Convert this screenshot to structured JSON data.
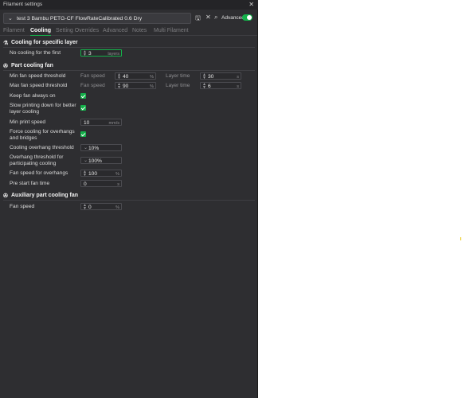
{
  "window": {
    "title": "Filament settings",
    "close_icon": "close-icon"
  },
  "toolbar": {
    "preset_name": "test 3 Bambu PETG-CF FlowRateCalibrated 0.6 Dry",
    "advanced_label": "Advanced",
    "advanced_on": true,
    "accent": "#14b14a"
  },
  "tabs": [
    "Filament",
    "Cooling",
    "Setting Overrides",
    "Advanced",
    "Notes",
    "Multi Filament"
  ],
  "active_tab": "Cooling",
  "cooling_specific_layer": {
    "title": "Cooling for specific layer",
    "no_cooling_label": "No cooling for the first",
    "no_cooling_value": "3",
    "no_cooling_unit": "layers"
  },
  "part_cooling_fan": {
    "title": "Part cooling fan",
    "min_threshold_label": "Min fan speed threshold",
    "max_threshold_label": "Max fan speed threshold",
    "fan_speed_label": "Fan speed",
    "layer_time_label": "Layer time",
    "min_fan_speed": "40",
    "min_layer_time": "30",
    "max_fan_speed": "90",
    "max_layer_time": "6",
    "percent_unit": "%",
    "seconds_unit": "s",
    "keep_fan_label": "Keep fan always on",
    "slow_printing_label": "Slow printing down for better layer cooling",
    "min_print_speed_label": "Min print speed",
    "min_print_speed": "10",
    "speed_unit": "mm/s",
    "force_cooling_label": "Force cooling for overhangs and bridges",
    "overhang_threshold_label": "Cooling overhang threshold",
    "overhang_threshold": "10%",
    "overhang_participating_label": "Overhang threshold for participating cooling",
    "overhang_participating": "100%",
    "fan_overhangs_label": "Fan speed for overhangs",
    "fan_overhangs": "100",
    "pre_start_label": "Pre start fan time",
    "pre_start": "0"
  },
  "aux_fan": {
    "title": "Auxiliary part cooling fan",
    "fan_speed_label": "Fan speed",
    "fan_speed": "0",
    "percent_unit": "%"
  }
}
